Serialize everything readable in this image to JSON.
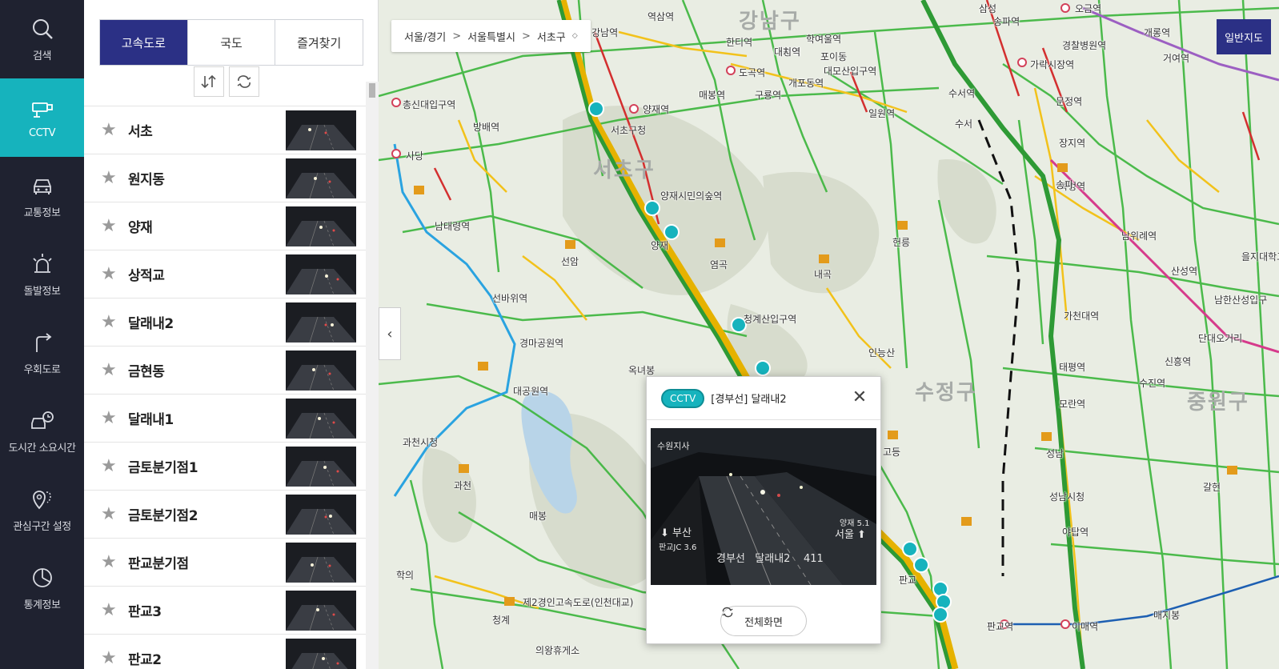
{
  "nav": {
    "items": [
      {
        "label": "검색",
        "icon": "search-icon"
      },
      {
        "label": "CCTV",
        "icon": "cctv-icon"
      },
      {
        "label": "교통정보",
        "icon": "car-icon"
      },
      {
        "label": "돌발정보",
        "icon": "siren-icon"
      },
      {
        "label": "우회도로",
        "icon": "detour-icon"
      },
      {
        "label": "도시간 소요시간",
        "icon": "car-clock-icon"
      },
      {
        "label": "관심구간 설정",
        "icon": "location-pin-icon"
      },
      {
        "label": "통계정보",
        "icon": "chart-icon"
      }
    ],
    "active_index": 1
  },
  "panel": {
    "tabs": [
      "고속도로",
      "국도",
      "즐겨찾기"
    ],
    "active_tab": 0,
    "sort_icon": "sort-icon",
    "refresh_icon": "refresh-icon",
    "cctv_list": [
      "서초",
      "원지동",
      "양재",
      "상적교",
      "달래내2",
      "금현동",
      "달래내1",
      "금토분기점1",
      "금토분기점2",
      "판교분기점",
      "판교3",
      "판교2"
    ]
  },
  "map": {
    "breadcrumb": [
      "서울/경기",
      "서울특별시",
      "서초구"
    ],
    "map_type": "일반지도",
    "districts": [
      "강남구",
      "서초구",
      "수정구",
      "중원구"
    ],
    "labels": {
      "l1": "양재역",
      "l2": "양재시민의숲역",
      "l3": "청계산입구역",
      "l4": "포이동",
      "l5": "개포동역",
      "l6": "대청역",
      "l7": "일원역",
      "l8": "수서역",
      "l9": "가락시장역",
      "l10": "문정역",
      "l11": "장지역",
      "l12": "복정역",
      "l13": "남위례역",
      "l14": "산성역",
      "l15": "가천대역",
      "l16": "태평역",
      "l17": "모란역",
      "l18": "신흥역",
      "l19": "수진역",
      "l20": "판교역",
      "l21": "이매역",
      "l22": "야탑역",
      "l23": "과천",
      "l24": "대공원역",
      "l25": "경마공원역",
      "l26": "선바위역",
      "l27": "남태령역",
      "l28": "사당",
      "l29": "인능산",
      "l30": "옥녀봉",
      "l31": "고등",
      "l32": "성남",
      "l33": "송파",
      "l34": "헌릉",
      "l35": "내곡",
      "l36": "염곡",
      "l37": "양재",
      "l38": "선암",
      "l39": "매봉",
      "l40": "학의",
      "l41": "청계",
      "l42": "의왕휴게소",
      "l43": "제2경인고속도로(인천대교)",
      "l44": "강남역",
      "l45": "방배역",
      "l46": "서초구청",
      "l47": "과천시청",
      "l48": "구룡역",
      "l49": "도곡역",
      "l50": "매봉역",
      "l51": "학여울역",
      "l52": "한티역",
      "l53": "대치역",
      "l54": "대모산입구역",
      "l55": "수서",
      "l56": "성남시청",
      "l57": "갈현",
      "l58": "을지대학교",
      "l59": "단대오거리",
      "l60": "남한산성입구",
      "l61": "총신대입구역",
      "l62": "오금역",
      "l63": "개롱역",
      "l64": "거여역",
      "l65": "경찰병원역",
      "l66": "송파역",
      "l67": "역삼역",
      "l68": "삼성",
      "l69": "매지봉",
      "l70": "판교"
    }
  },
  "popup": {
    "badge": "CCTV",
    "title": "[경부선] 달래내2",
    "close_icon": "close-icon",
    "video": {
      "station": "수원지사",
      "left_dir": "부산",
      "left_sub": "판교JC 3.6",
      "right_sub": "양재 5.1",
      "right_dir": "서울",
      "caption": "경부선   달래내2    411"
    },
    "fullscreen_label": "전체화면"
  },
  "colors": {
    "nav_bg": "#1f2230",
    "nav_active": "#16b3bd",
    "tab_active": "#2b3085",
    "road_green": "#3bb53b",
    "road_yellow": "#f2c21b",
    "road_red": "#d32f2f",
    "subway_blue": "#2aa3e0",
    "subway_purple": "#9c5fc2",
    "subway_pink": "#d63a8b"
  }
}
